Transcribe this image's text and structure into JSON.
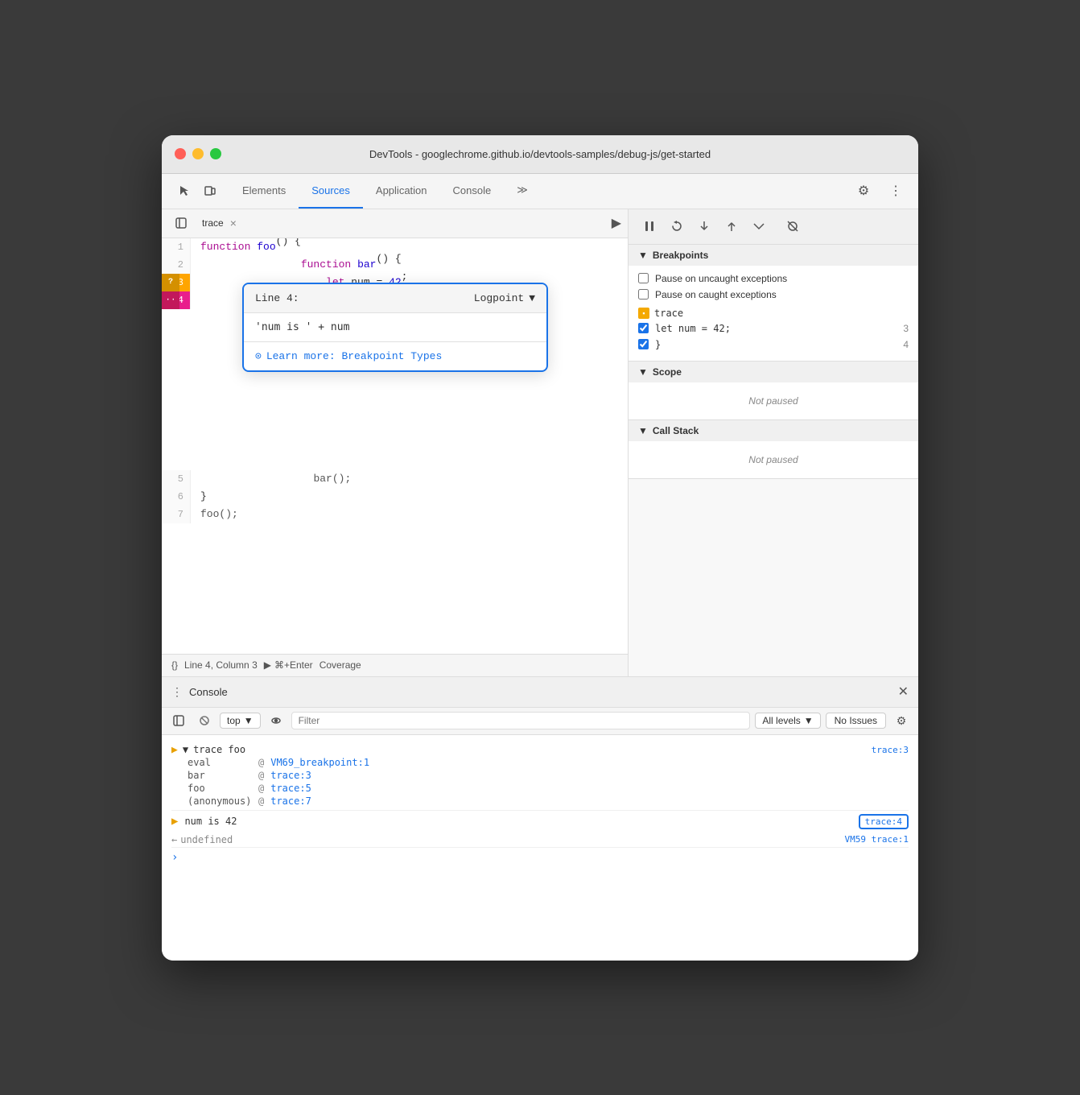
{
  "window": {
    "title": "DevTools - googlechrome.github.io/devtools-samples/debug-js/get-started"
  },
  "toolbar": {
    "tabs": [
      {
        "id": "elements",
        "label": "Elements"
      },
      {
        "id": "sources",
        "label": "Sources"
      },
      {
        "id": "application",
        "label": "Application"
      },
      {
        "id": "console",
        "label": "Console"
      }
    ],
    "more_icon": "≫",
    "gear_icon": "⚙",
    "dots_icon": "⋮"
  },
  "editor": {
    "tab_name": "trace",
    "code_lines": [
      {
        "num": 1,
        "content": "function foo() {"
      },
      {
        "num": 2,
        "content": "  function bar() {"
      },
      {
        "num": 3,
        "content": "    let num = 42;"
      },
      {
        "num": 4,
        "content": "  }"
      },
      {
        "num": 5,
        "content": "  bar();"
      },
      {
        "num": 6,
        "content": "}"
      },
      {
        "num": 7,
        "content": "foo();"
      }
    ],
    "expander_icon": "▶"
  },
  "logpoint": {
    "label": "Line 4:",
    "type": "Logpoint",
    "input_value": "'num is ' + num",
    "link_text": "Learn more: Breakpoint Types",
    "link_icon": "→"
  },
  "status_bar": {
    "icon": "{}",
    "position": "Line 4, Column 3",
    "run_label": "⌘+Enter",
    "coverage": "Coverage"
  },
  "debug_toolbar": {
    "pause_icon": "⏸",
    "reload_icon": "↺",
    "step_over": "↓",
    "step_out": "↑",
    "step_next": "→→",
    "disable_icon": "⊘"
  },
  "breakpoints": {
    "section_label": "Breakpoints",
    "pause_uncaught": "Pause on uncaught exceptions",
    "pause_caught": "Pause on caught exceptions",
    "items": [
      {
        "file": "trace",
        "code": "let num = 42;",
        "line": "3",
        "checked": true
      },
      {
        "file": "trace",
        "code": "}",
        "line": "4",
        "checked": true
      }
    ]
  },
  "scope": {
    "section_label": "Scope",
    "empty_text": "Not paused"
  },
  "callstack": {
    "section_label": "Call Stack",
    "empty_text": "Not paused"
  },
  "console": {
    "title": "Console",
    "close_icon": "✕",
    "toolbar": {
      "clear_icon": "🚫",
      "context_label": "top",
      "eye_icon": "👁",
      "filter_placeholder": "Filter",
      "log_level": "All levels",
      "no_issues": "No Issues",
      "settings_icon": "⚙"
    },
    "group": {
      "icon": "▶",
      "name": "trace foo",
      "link": "trace:3"
    },
    "stack_items": [
      {
        "label": "eval",
        "at": "@",
        "link": "VM69_breakpoint:1"
      },
      {
        "label": "bar",
        "at": "@",
        "link": "trace:3"
      },
      {
        "label": "foo",
        "at": "@",
        "link": "trace:5"
      },
      {
        "label": "(anonymous)",
        "at": "@",
        "link": "trace:7"
      }
    ],
    "output": {
      "text": "num is 42",
      "link": "trace:4"
    },
    "undefined_line": {
      "arrow": "←",
      "text": "undefined",
      "link": "VM59 trace:1"
    }
  }
}
